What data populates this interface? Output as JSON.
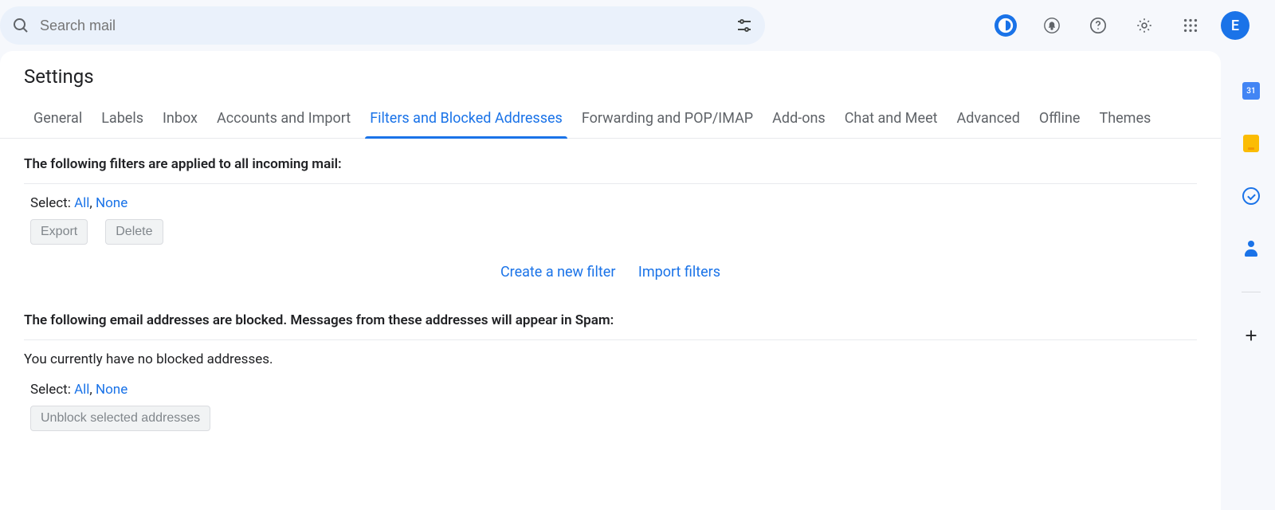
{
  "search": {
    "placeholder": "Search mail"
  },
  "avatar": {
    "initial": "E"
  },
  "page": {
    "title": "Settings"
  },
  "tabs": [
    {
      "label": "General",
      "id": "general",
      "active": false
    },
    {
      "label": "Labels",
      "id": "labels",
      "active": false
    },
    {
      "label": "Inbox",
      "id": "inbox",
      "active": false
    },
    {
      "label": "Accounts and Import",
      "id": "accounts",
      "active": false
    },
    {
      "label": "Filters and Blocked Addresses",
      "id": "filters",
      "active": true
    },
    {
      "label": "Forwarding and POP/IMAP",
      "id": "forwarding",
      "active": false
    },
    {
      "label": "Add-ons",
      "id": "addons",
      "active": false
    },
    {
      "label": "Chat and Meet",
      "id": "chat",
      "active": false
    },
    {
      "label": "Advanced",
      "id": "advanced",
      "active": false
    },
    {
      "label": "Offline",
      "id": "offline",
      "active": false
    },
    {
      "label": "Themes",
      "id": "themes",
      "active": false
    }
  ],
  "filters": {
    "heading": "The following filters are applied to all incoming mail:",
    "select_label": "Select:",
    "select_all": "All",
    "select_none": "None",
    "export_btn": "Export",
    "delete_btn": "Delete",
    "create_link": "Create a new filter",
    "import_link": "Import filters"
  },
  "blocked": {
    "heading": "The following email addresses are blocked. Messages from these addresses will appear in Spam:",
    "empty": "You currently have no blocked addresses.",
    "select_label": "Select:",
    "select_all": "All",
    "select_none": "None",
    "unblock_btn": "Unblock selected addresses"
  }
}
